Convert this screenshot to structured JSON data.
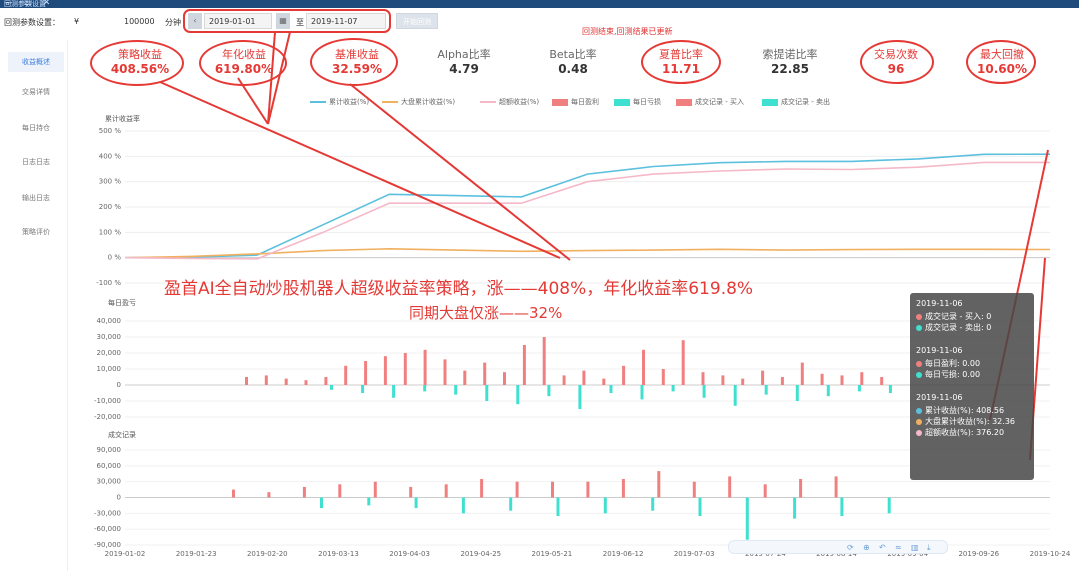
{
  "window": {
    "title": "回测参数设置",
    "controls": "— ☐ ✕"
  },
  "toolbar": {
    "setting_label": "回测参数设置：",
    "currency": "¥",
    "capital": "100000",
    "period_label": "分钟",
    "start_date": "2019-01-01",
    "to_label": "至",
    "end_date": "2019-11-07",
    "run_button": "开始回测",
    "notice": "回测结束,回测结果已更新"
  },
  "sidebar": {
    "items": [
      {
        "label": "收益概述"
      },
      {
        "label": "交易详情"
      },
      {
        "label": "每日持仓"
      },
      {
        "label": "日志日志"
      },
      {
        "label": "输出日志"
      },
      {
        "label": "策略评价"
      }
    ]
  },
  "metrics": [
    {
      "label": "策略收益",
      "value": "408.56%",
      "highlight": true
    },
    {
      "label": "年化收益",
      "value": "619.80%",
      "highlight": true
    },
    {
      "label": "基准收益",
      "value": "32.59%",
      "highlight": true
    },
    {
      "label": "Alpha比率",
      "value": "4.79",
      "highlight": false
    },
    {
      "label": "Beta比率",
      "value": "0.48",
      "highlight": false
    },
    {
      "label": "夏普比率",
      "value": "11.71",
      "highlight": true
    },
    {
      "label": "索提诺比率",
      "value": "22.85",
      "highlight": false
    },
    {
      "label": "交易次数",
      "value": "96",
      "highlight": true
    },
    {
      "label": "最大回撤",
      "value": "10.60%",
      "highlight": true
    }
  ],
  "legend": [
    {
      "label": "累计收益(%)",
      "color": "#5bc0de",
      "kind": "line"
    },
    {
      "label": "大盘累计收益(%)",
      "color": "#f0b060",
      "kind": "line"
    },
    {
      "label": "超额收益(%)",
      "color": "#f5b8c8",
      "kind": "line"
    },
    {
      "label": "每日盈利",
      "color": "#f08080",
      "kind": "box"
    },
    {
      "label": "每日亏损",
      "color": "#40e0d0",
      "kind": "box"
    },
    {
      "label": "成交记录 - 买入",
      "color": "#f08080",
      "kind": "box"
    },
    {
      "label": "成交记录 - 卖出",
      "color": "#40e0d0",
      "kind": "box"
    }
  ],
  "annotations": {
    "headline": "盈首AI全自动炒股机器人超级收益率策略，涨——408%，年化收益率619.8%",
    "subline": "同期大盘仅涨——32%"
  },
  "tooltip": {
    "groups": [
      {
        "date": "2019-11-06",
        "rows": [
          {
            "label": "成交记录 - 买入",
            "value": "0",
            "color": "#f08080"
          },
          {
            "label": "成交记录 - 卖出",
            "value": "0",
            "color": "#40e0d0"
          }
        ]
      },
      {
        "date": "2019-11-06",
        "rows": [
          {
            "label": "每日盈利",
            "value": "0.00",
            "color": "#f08080"
          },
          {
            "label": "每日亏损",
            "value": "0.00",
            "color": "#40e0d0"
          }
        ]
      },
      {
        "date": "2019-11-06",
        "rows": [
          {
            "label": "累计收益(%)",
            "value": "408.56",
            "color": "#5bc0de"
          },
          {
            "label": "大盘累计收益(%)",
            "value": "32.36",
            "color": "#f0b060"
          },
          {
            "label": "超额收益(%)",
            "value": "376.20",
            "color": "#f5b8c8"
          }
        ]
      }
    ]
  },
  "chart_data": [
    {
      "type": "line",
      "title": "累计收益率",
      "ylim": [
        -100,
        500
      ],
      "yticks": [
        "500 %",
        "400 %",
        "300 %",
        "200 %",
        "100 %",
        "0 %",
        "-100 %"
      ],
      "x": [
        "2019-01-02",
        "2019-01-23",
        "2019-02-20",
        "2019-03-13",
        "2019-04-03",
        "2019-04-25",
        "2019-05-21",
        "2019-06-12",
        "2019-07-03",
        "2019-07-24",
        "2019-08-14",
        "2019-09-04",
        "2019-09-26",
        "2019-10-24",
        "2019-11-06"
      ],
      "series": [
        {
          "name": "累计收益(%)",
          "color": "#5bc0de",
          "values": [
            0,
            2,
            10,
            130,
            250,
            245,
            240,
            330,
            360,
            375,
            380,
            380,
            390,
            408,
            408.56
          ]
        },
        {
          "name": "大盘累计收益(%)",
          "color": "#f0b060",
          "values": [
            0,
            5,
            15,
            28,
            35,
            30,
            25,
            28,
            30,
            33,
            30,
            32,
            33,
            33,
            32.36
          ]
        },
        {
          "name": "超额收益(%)",
          "color": "#f5b8c8",
          "values": [
            0,
            -3,
            -5,
            100,
            215,
            215,
            215,
            300,
            330,
            342,
            350,
            348,
            357,
            376,
            376.2
          ]
        }
      ]
    },
    {
      "type": "bar",
      "title": "每日盈亏",
      "ylim": [
        -20000,
        40000
      ],
      "yticks": [
        "40,000",
        "30,000",
        "20,000",
        "10,000",
        "0",
        "-10,000",
        "-20,000"
      ],
      "series": [
        {
          "name": "每日盈利",
          "color": "#f08080",
          "values": [
            5000,
            6000,
            4000,
            3000,
            5000,
            12000,
            15000,
            18000,
            20000,
            22000,
            16000,
            9000,
            14000,
            8000,
            25000,
            30000,
            6000,
            9000,
            4000,
            12000,
            22000,
            10000,
            28000,
            8000,
            6000,
            4000,
            9000,
            5000,
            14000,
            7000,
            6000,
            8000,
            5000
          ]
        },
        {
          "name": "每日亏损",
          "color": "#40e0d0",
          "values": [
            -3000,
            -5000,
            -8000,
            -4000,
            -6000,
            -10000,
            -12000,
            -7000,
            -15000,
            -5000,
            -9000,
            -4000,
            -8000,
            -13000,
            -6000,
            -10000,
            -7000,
            -4000,
            -5000
          ]
        }
      ]
    },
    {
      "type": "bar",
      "title": "成交记录",
      "ylim": [
        -90000,
        90000
      ],
      "yticks": [
        "90,000",
        "60,000",
        "30,000",
        "0",
        "-30,000",
        "-60,000",
        "-90,000"
      ],
      "series": [
        {
          "name": "成交记录 - 买入",
          "color": "#f08080",
          "values": [
            15000,
            10000,
            20000,
            25000,
            30000,
            20000,
            25000,
            35000,
            30000,
            30000,
            30000,
            35000,
            50000,
            30000,
            40000,
            25000,
            35000,
            40000
          ]
        },
        {
          "name": "成交记录 - 卖出",
          "color": "#40e0d0",
          "values": [
            -20000,
            -15000,
            -20000,
            -30000,
            -25000,
            -35000,
            -30000,
            -25000,
            -35000,
            -80000,
            -40000,
            -35000,
            -30000
          ]
        }
      ]
    }
  ]
}
